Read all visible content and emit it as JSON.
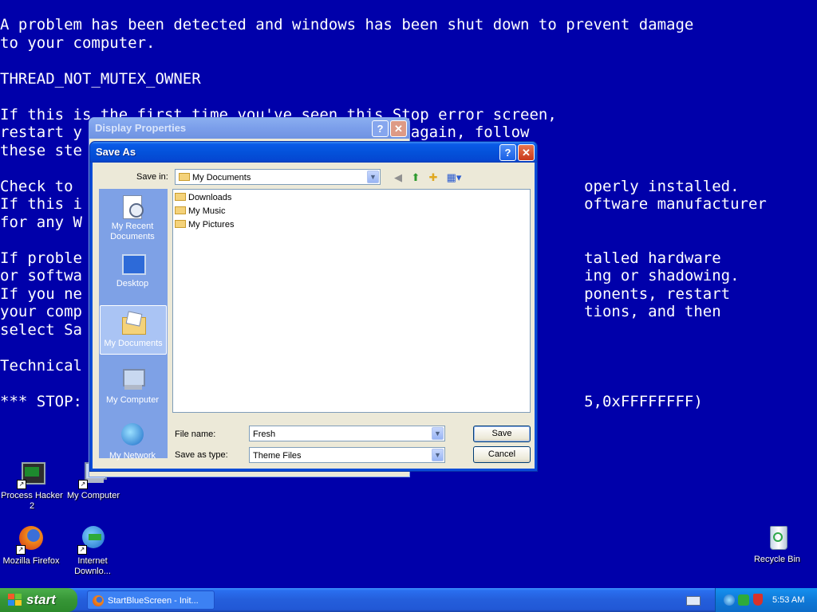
{
  "bsod": {
    "lines": [
      "A problem has been detected and windows has been shut down to prevent damage",
      "to your computer.",
      "",
      "THREAD_NOT_MUTEX_OWNER",
      "",
      "If this is the first time you've seen this Stop error screen,",
      "restart y                              pears again, follow",
      "these ste",
      "",
      "Check to                                                        operly installed.",
      "If this i                                                       oftware manufacturer",
      "for any W",
      "",
      "If proble                                                       talled hardware",
      "or softwa                                                       ing or shadowing.",
      "If you ne                                                       ponents, restart",
      "your comp                                                       tions, and then",
      "select Sa",
      "",
      "Technical",
      "",
      "*** STOP:                                                       5,0xFFFFFFFF)"
    ]
  },
  "desktop_icons": [
    {
      "label": "Process Hacker 2"
    },
    {
      "label": "My Computer"
    },
    {
      "label": "Mozilla Firefox"
    },
    {
      "label": "Internet Downlo..."
    },
    {
      "label": "Recycle Bin"
    }
  ],
  "display_properties": {
    "title": "Display Properties",
    "help": "?",
    "close": "✕"
  },
  "save_as": {
    "title": "Save As",
    "help": "?",
    "close": "✕",
    "save_in_label": "Save in:",
    "save_in_value": "My Documents",
    "places": [
      {
        "label": "My Recent Documents"
      },
      {
        "label": "Desktop"
      },
      {
        "label": "My Documents"
      },
      {
        "label": "My Computer"
      },
      {
        "label": "My Network"
      }
    ],
    "files": [
      "Downloads",
      "My Music",
      "My Pictures"
    ],
    "file_name_label": "File name:",
    "file_name_value": "Fresh",
    "save_type_label": "Save as type:",
    "save_type_value": "Theme Files",
    "save_button": "Save",
    "cancel_button": "Cancel"
  },
  "taskbar": {
    "start_label": "start",
    "task_label": "StartBlueScreen - Init...",
    "clock": "5:53 AM"
  }
}
